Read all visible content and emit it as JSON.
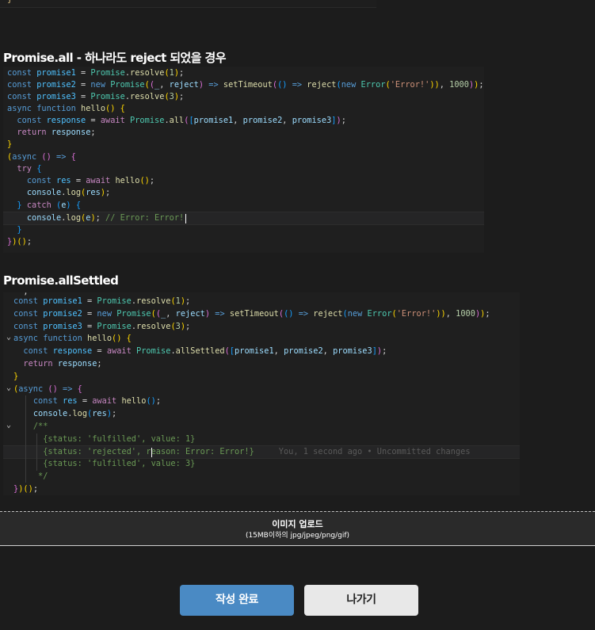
{
  "top_snippet": {
    "text": "}"
  },
  "section1": {
    "title": "Promise.all - 하나라도 reject 되었을 경우",
    "code": {
      "l1": [
        [
          "kw",
          "const"
        ],
        [
          "pu",
          " "
        ],
        [
          "cn",
          "promise1"
        ],
        [
          "pu",
          " = "
        ],
        [
          "cls",
          "Promise"
        ],
        [
          "pu",
          "."
        ],
        [
          "fn",
          "resolve"
        ],
        [
          "b1",
          "("
        ],
        [
          "num",
          "1"
        ],
        [
          "b1",
          ")"
        ],
        [
          "pu",
          ";"
        ]
      ],
      "l2": [
        [
          "kw",
          "const"
        ],
        [
          "pu",
          " "
        ],
        [
          "cn",
          "promise2"
        ],
        [
          "pu",
          " = "
        ],
        [
          "kw",
          "new"
        ],
        [
          "pu",
          " "
        ],
        [
          "cls",
          "Promise"
        ],
        [
          "b1",
          "("
        ],
        [
          "b2",
          "("
        ],
        [
          "vr",
          "_"
        ],
        [
          "pu",
          ", "
        ],
        [
          "vr",
          "reject"
        ],
        [
          "b2",
          ")"
        ],
        [
          "pu",
          " "
        ],
        [
          "kw",
          "=>"
        ],
        [
          "pu",
          " "
        ],
        [
          "fn",
          "setTimeout"
        ],
        [
          "b2",
          "("
        ],
        [
          "b3",
          "()"
        ],
        [
          "pu",
          " "
        ],
        [
          "kw",
          "=>"
        ],
        [
          "pu",
          " "
        ],
        [
          "fn",
          "reject"
        ],
        [
          "b3",
          "("
        ],
        [
          "kw",
          "new"
        ],
        [
          "pu",
          " "
        ],
        [
          "cls",
          "Error"
        ],
        [
          "b1",
          "("
        ],
        [
          "str",
          "'Error!'"
        ],
        [
          "b1",
          "))"
        ],
        [
          "pu",
          ", "
        ],
        [
          "num",
          "1000"
        ],
        [
          "b2",
          ")"
        ],
        [
          "b1",
          ")"
        ],
        [
          "pu",
          ";"
        ]
      ],
      "l3": [
        [
          "kw",
          "const"
        ],
        [
          "pu",
          " "
        ],
        [
          "cn",
          "promise3"
        ],
        [
          "pu",
          " = "
        ],
        [
          "cls",
          "Promise"
        ],
        [
          "pu",
          "."
        ],
        [
          "fn",
          "resolve"
        ],
        [
          "b1",
          "("
        ],
        [
          "num",
          "3"
        ],
        [
          "b1",
          ")"
        ],
        [
          "pu",
          ";"
        ]
      ],
      "l4": [
        [
          "kw",
          "async"
        ],
        [
          "pu",
          " "
        ],
        [
          "kw",
          "function"
        ],
        [
          "pu",
          " "
        ],
        [
          "fn",
          "hello"
        ],
        [
          "b1",
          "()"
        ],
        [
          "pu",
          " "
        ],
        [
          "b1",
          "{"
        ]
      ],
      "l5": [
        [
          "pu",
          "  "
        ],
        [
          "kw",
          "const"
        ],
        [
          "pu",
          " "
        ],
        [
          "cn",
          "response"
        ],
        [
          "pu",
          " = "
        ],
        [
          "ctl",
          "await"
        ],
        [
          "pu",
          " "
        ],
        [
          "cls",
          "Promise"
        ],
        [
          "pu",
          "."
        ],
        [
          "fn",
          "all"
        ],
        [
          "b2",
          "("
        ],
        [
          "b3",
          "["
        ],
        [
          "vr",
          "promise1"
        ],
        [
          "pu",
          ", "
        ],
        [
          "vr",
          "promise2"
        ],
        [
          "pu",
          ", "
        ],
        [
          "vr",
          "promise3"
        ],
        [
          "b3",
          "]"
        ],
        [
          "b2",
          ")"
        ],
        [
          "pu",
          ";"
        ]
      ],
      "l6": [
        [
          "pu",
          "  "
        ],
        [
          "ctl",
          "return"
        ],
        [
          "pu",
          " "
        ],
        [
          "vr",
          "response"
        ],
        [
          "pu",
          ";"
        ]
      ],
      "l7": [
        [
          "b1",
          "}"
        ]
      ],
      "l8": [
        [
          "b1",
          "("
        ],
        [
          "kw",
          "async"
        ],
        [
          "pu",
          " "
        ],
        [
          "b2",
          "()"
        ],
        [
          "pu",
          " "
        ],
        [
          "kw",
          "=>"
        ],
        [
          "pu",
          " "
        ],
        [
          "b2",
          "{"
        ]
      ],
      "l9": [
        [
          "pu",
          "  "
        ],
        [
          "ctl",
          "try"
        ],
        [
          "pu",
          " "
        ],
        [
          "b3",
          "{"
        ]
      ],
      "l10": [
        [
          "pu",
          "    "
        ],
        [
          "kw",
          "const"
        ],
        [
          "pu",
          " "
        ],
        [
          "cn",
          "res"
        ],
        [
          "pu",
          " = "
        ],
        [
          "ctl",
          "await"
        ],
        [
          "pu",
          " "
        ],
        [
          "fn",
          "hello"
        ],
        [
          "b1",
          "()"
        ],
        [
          "pu",
          ";"
        ]
      ],
      "l11": [
        [
          "pu",
          "    "
        ],
        [
          "vr",
          "console"
        ],
        [
          "pu",
          "."
        ],
        [
          "fn",
          "log"
        ],
        [
          "b1",
          "("
        ],
        [
          "vr",
          "res"
        ],
        [
          "b1",
          ")"
        ],
        [
          "pu",
          ";"
        ]
      ],
      "l12": [
        [
          "pu",
          "  "
        ],
        [
          "b3",
          "}"
        ],
        [
          "pu",
          " "
        ],
        [
          "ctl",
          "catch"
        ],
        [
          "pu",
          " "
        ],
        [
          "b3",
          "("
        ],
        [
          "vr",
          "e"
        ],
        [
          "b3",
          ")"
        ],
        [
          "pu",
          " "
        ],
        [
          "b3",
          "{"
        ]
      ],
      "l13": [
        [
          "pu",
          "    "
        ],
        [
          "vr",
          "console"
        ],
        [
          "pu",
          "."
        ],
        [
          "fn",
          "log"
        ],
        [
          "b1",
          "("
        ],
        [
          "vr",
          "e"
        ],
        [
          "b1",
          ")"
        ],
        [
          "pu",
          "; "
        ],
        [
          "cm",
          "// Error: Error!"
        ]
      ],
      "l14": [
        [
          "pu",
          "  "
        ],
        [
          "b3",
          "}"
        ]
      ],
      "l15": [
        [
          "b2",
          "}"
        ],
        [
          "b1",
          ")()"
        ],
        [
          "pu",
          ";"
        ]
      ]
    }
  },
  "section2": {
    "title": "Promise.allSettled",
    "code": {
      "l0": [
        [
          "pu",
          "  ,"
        ]
      ],
      "l1": [
        [
          "kw",
          "const"
        ],
        [
          "pu",
          " "
        ],
        [
          "cn",
          "promise1"
        ],
        [
          "pu",
          " = "
        ],
        [
          "cls",
          "Promise"
        ],
        [
          "pu",
          "."
        ],
        [
          "fn",
          "resolve"
        ],
        [
          "b1",
          "("
        ],
        [
          "num",
          "1"
        ],
        [
          "b1",
          ")"
        ],
        [
          "pu",
          ";"
        ]
      ],
      "l2": [
        [
          "kw",
          "const"
        ],
        [
          "pu",
          " "
        ],
        [
          "cn",
          "promise2"
        ],
        [
          "pu",
          " = "
        ],
        [
          "kw",
          "new"
        ],
        [
          "pu",
          " "
        ],
        [
          "cls",
          "Promise"
        ],
        [
          "b1",
          "("
        ],
        [
          "b2",
          "("
        ],
        [
          "vr",
          "_"
        ],
        [
          "pu",
          ", "
        ],
        [
          "vr",
          "reject"
        ],
        [
          "b2",
          ")"
        ],
        [
          "pu",
          " "
        ],
        [
          "kw",
          "=>"
        ],
        [
          "pu",
          " "
        ],
        [
          "fn",
          "setTimeout"
        ],
        [
          "b2",
          "("
        ],
        [
          "b3",
          "()"
        ],
        [
          "pu",
          " "
        ],
        [
          "kw",
          "=>"
        ],
        [
          "pu",
          " "
        ],
        [
          "fn",
          "reject"
        ],
        [
          "b3",
          "("
        ],
        [
          "kw",
          "new"
        ],
        [
          "pu",
          " "
        ],
        [
          "cls",
          "Error"
        ],
        [
          "b1",
          "("
        ],
        [
          "str",
          "'Error!'"
        ],
        [
          "b1",
          "))"
        ],
        [
          "pu",
          ", "
        ],
        [
          "num",
          "1000"
        ],
        [
          "b2",
          ")"
        ],
        [
          "b1",
          ")"
        ],
        [
          "pu",
          ";"
        ]
      ],
      "l3": [
        [
          "kw",
          "const"
        ],
        [
          "pu",
          " "
        ],
        [
          "cn",
          "promise3"
        ],
        [
          "pu",
          " = "
        ],
        [
          "cls",
          "Promise"
        ],
        [
          "pu",
          "."
        ],
        [
          "fn",
          "resolve"
        ],
        [
          "b1",
          "("
        ],
        [
          "num",
          "3"
        ],
        [
          "b1",
          ")"
        ],
        [
          "pu",
          ";"
        ]
      ],
      "l4": [
        [
          "kw",
          "async"
        ],
        [
          "pu",
          " "
        ],
        [
          "kw",
          "function"
        ],
        [
          "pu",
          " "
        ],
        [
          "fn",
          "hello"
        ],
        [
          "b1",
          "()"
        ],
        [
          "pu",
          " "
        ],
        [
          "b1",
          "{"
        ]
      ],
      "l5": [
        [
          "pu",
          "  "
        ],
        [
          "kw",
          "const"
        ],
        [
          "pu",
          " "
        ],
        [
          "cn",
          "response"
        ],
        [
          "pu",
          " = "
        ],
        [
          "ctl",
          "await"
        ],
        [
          "pu",
          " "
        ],
        [
          "cls",
          "Promise"
        ],
        [
          "pu",
          "."
        ],
        [
          "fn",
          "allSettled"
        ],
        [
          "b2",
          "("
        ],
        [
          "b3",
          "["
        ],
        [
          "vr",
          "promise1"
        ],
        [
          "pu",
          ", "
        ],
        [
          "vr",
          "promise2"
        ],
        [
          "pu",
          ", "
        ],
        [
          "vr",
          "promise3"
        ],
        [
          "b3",
          "]"
        ],
        [
          "b2",
          ")"
        ],
        [
          "pu",
          ";"
        ]
      ],
      "l6": [
        [
          "pu",
          "  "
        ],
        [
          "ctl",
          "return"
        ],
        [
          "pu",
          " "
        ],
        [
          "vr",
          "response"
        ],
        [
          "pu",
          ";"
        ]
      ],
      "l7": [
        [
          "b1",
          "}"
        ]
      ],
      "l8": [
        [
          "b1",
          "("
        ],
        [
          "kw",
          "async"
        ],
        [
          "pu",
          " "
        ],
        [
          "b2",
          "()"
        ],
        [
          "pu",
          " "
        ],
        [
          "kw",
          "=>"
        ],
        [
          "pu",
          " "
        ],
        [
          "b2",
          "{"
        ]
      ],
      "l9": [
        [
          "pu",
          "    "
        ],
        [
          "kw",
          "const"
        ],
        [
          "pu",
          " "
        ],
        [
          "cn",
          "res"
        ],
        [
          "pu",
          " = "
        ],
        [
          "ctl",
          "await"
        ],
        [
          "pu",
          " "
        ],
        [
          "fn",
          "hello"
        ],
        [
          "b3",
          "()"
        ],
        [
          "pu",
          ";"
        ]
      ],
      "l10": [
        [
          "pu",
          "    "
        ],
        [
          "vr",
          "console"
        ],
        [
          "pu",
          "."
        ],
        [
          "fn",
          "log"
        ],
        [
          "b3",
          "("
        ],
        [
          "vr",
          "res"
        ],
        [
          "b3",
          ")"
        ],
        [
          "pu",
          ";"
        ]
      ],
      "l11": [
        [
          "pu",
          "    "
        ],
        [
          "doc",
          "/**"
        ]
      ],
      "l12": [
        [
          "pu",
          "      "
        ],
        [
          "doc",
          "{status: 'fulfilled', value: 1}"
        ]
      ],
      "l13": [
        [
          "pu",
          "      "
        ],
        [
          "doc",
          "{status: 'rejected', reason: Error: Error!}"
        ],
        [
          "ghost",
          "     You, 1 second ago • Uncommitted changes"
        ]
      ],
      "l14": [
        [
          "pu",
          "      "
        ],
        [
          "doc",
          "{status: 'fulfilled', value: 3}"
        ]
      ],
      "l15": [
        [
          "pu",
          "     "
        ],
        [
          "doc",
          "*/"
        ]
      ],
      "l16": [
        [
          "b2",
          "}"
        ],
        [
          "b1",
          ")()"
        ],
        [
          "pu",
          ";"
        ]
      ]
    }
  },
  "upload": {
    "title": "이미지 업로드",
    "subtitle": "(15MB이하의 jpg/jpeg/png/gif)"
  },
  "buttons": {
    "submit": "작성 완료",
    "exit": "나가기"
  }
}
